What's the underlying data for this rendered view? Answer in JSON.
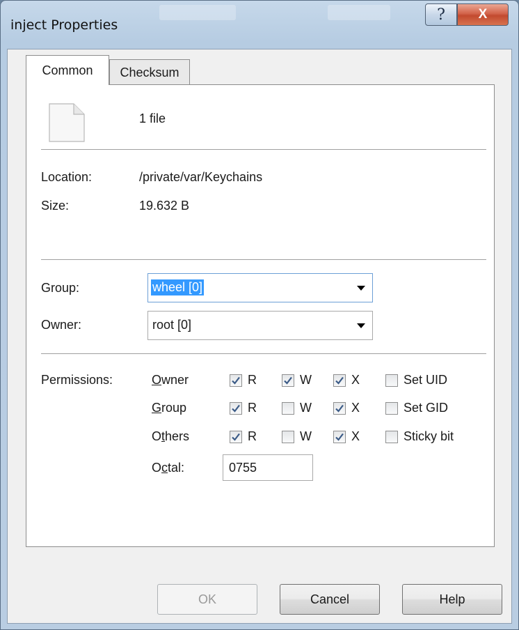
{
  "window": {
    "title": "inject Properties",
    "help_label": "?",
    "close_label": "X"
  },
  "tabs": [
    {
      "label": "Common",
      "active": true
    },
    {
      "label": "Checksum",
      "active": false
    }
  ],
  "summary": {
    "file_count": "1 file",
    "icon": "document-icon"
  },
  "details": {
    "location_label": "Location:",
    "location_value": "/private/var/Keychains",
    "size_label": "Size:",
    "size_value": "19.632 B"
  },
  "ownership": {
    "group_label": "Group:",
    "group_value": "wheel [0]",
    "owner_label": "Owner:",
    "owner_value": "root [0]"
  },
  "permissions": {
    "label": "Permissions:",
    "rows": [
      {
        "pre": "",
        "key": "O",
        "post": "wner",
        "r": true,
        "w": true,
        "x": true,
        "special": "Set UID",
        "special_checked": false
      },
      {
        "pre": "",
        "key": "G",
        "post": "roup",
        "r": true,
        "w": false,
        "x": true,
        "special": "Set GID",
        "special_checked": false
      },
      {
        "pre": "O",
        "key": "t",
        "post": "hers",
        "r": true,
        "w": false,
        "x": true,
        "special": "Sticky bit",
        "special_checked": false
      }
    ],
    "r_label": "R",
    "w_label": "W",
    "x_label": "X",
    "octal_pre": "O",
    "octal_key": "c",
    "octal_post": "tal:",
    "octal_value": "0755"
  },
  "buttons": {
    "ok": "OK",
    "cancel": "Cancel",
    "help": "Help"
  },
  "colors": {
    "selection": "#3399ff",
    "close_button": "#c9492c",
    "check": "#3a5a86"
  }
}
